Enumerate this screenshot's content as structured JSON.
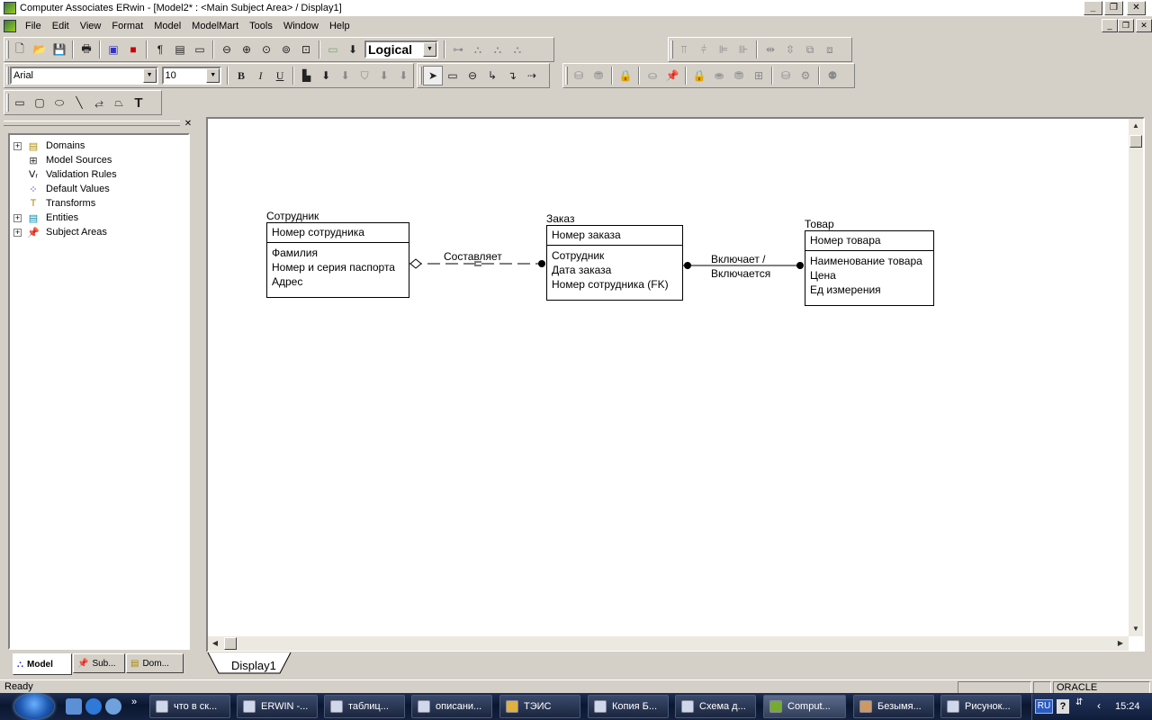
{
  "window": {
    "title": "Computer Associates ERwin - [Model2* : <Main Subject Area> / Display1]"
  },
  "menu": [
    "File",
    "Edit",
    "View",
    "Format",
    "Model",
    "ModelMart",
    "Tools",
    "Window",
    "Help"
  ],
  "toolbar": {
    "view_mode": "Logical",
    "font_name": "Arial",
    "font_size": "10",
    "bold": "B",
    "italic": "I",
    "underline": "U",
    "text_tool": "T"
  },
  "tree": {
    "items": [
      {
        "label": "Domains",
        "expandable": true,
        "icon": "domains-icon"
      },
      {
        "label": "Model Sources",
        "expandable": false,
        "icon": "model-sources-icon"
      },
      {
        "label": "Validation Rules",
        "expandable": false,
        "icon": "validation-rules-icon"
      },
      {
        "label": "Default Values",
        "expandable": false,
        "icon": "default-values-icon"
      },
      {
        "label": "Transforms",
        "expandable": false,
        "icon": "transforms-icon"
      },
      {
        "label": "Entities",
        "expandable": true,
        "icon": "entities-icon"
      },
      {
        "label": "Subject Areas",
        "expandable": true,
        "icon": "subject-areas-icon"
      }
    ],
    "tabs": [
      "Model",
      "Sub...",
      "Dom..."
    ]
  },
  "diagram": {
    "entities": [
      {
        "name": "Сотрудник",
        "key": "Номер сотрудника",
        "attrs": [
          "Фамилия",
          "Номер и серия паспорта",
          "Адрес"
        ]
      },
      {
        "name": "Заказ",
        "key": "Номер заказа",
        "attrs": [
          "Сотрудник",
          "Дата заказа",
          "Номер сотрудника (FK)"
        ]
      },
      {
        "name": "Товар",
        "key": "Номер товара",
        "attrs": [
          "Наименование товара",
          "Цена",
          "Ед измерения"
        ]
      }
    ],
    "relationships": [
      {
        "label": "Составляет"
      },
      {
        "label_line1": "Включает /",
        "label_line2": "Включается"
      }
    ],
    "tab": "Display1"
  },
  "status": {
    "text": "Ready",
    "db": "ORACLE"
  },
  "taskbar": {
    "buttons": [
      "что в ск...",
      "ERWIN -...",
      "таблиц...",
      "описани...",
      "ТЭИС",
      "Копия Б...",
      "Схема д...",
      "Comput...",
      "Безымя...",
      "Рисунок..."
    ],
    "lang": "RU",
    "clock": "15:24"
  }
}
